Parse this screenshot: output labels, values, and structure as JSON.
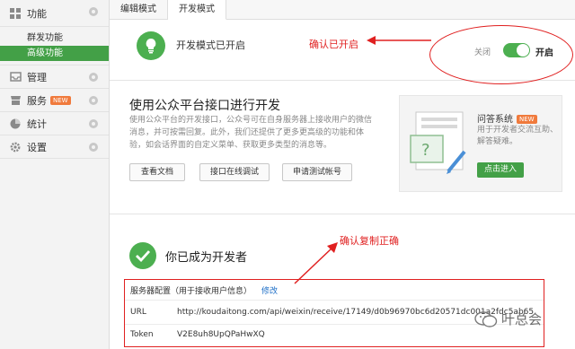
{
  "sidebar": {
    "groups": [
      {
        "label": "功能",
        "icon": "grid-icon"
      },
      {
        "label": "管理",
        "icon": "inbox-icon"
      },
      {
        "label": "服务",
        "icon": "store-icon",
        "badge": "NEW"
      },
      {
        "label": "统计",
        "icon": "pie-icon"
      },
      {
        "label": "设置",
        "icon": "gear-icon"
      }
    ],
    "sub_items": [
      {
        "label": "群发功能"
      },
      {
        "label": "高级功能"
      }
    ]
  },
  "tabs": [
    {
      "label": "编辑模式"
    },
    {
      "label": "开发模式"
    }
  ],
  "dev_mode": {
    "status": "开发模式已开启",
    "annotation": "确认已开启",
    "toggle_off_label": "关闭",
    "toggle_on_label": "开启",
    "toggle_state": "on"
  },
  "api": {
    "title": "使用公众平台接口进行开发",
    "description": "使用公众平台的开发接口，公众号可在自身服务器上接收用户的微信消息，并可按需回复。此外，我们还提供了更多更高级的功能和体验，如会话界面的自定义菜单、获取更多类型的消息等。",
    "buttons": [
      "查看文档",
      "接口在线调试",
      "申请测试帐号"
    ],
    "qa": {
      "title": "问答系统",
      "badge": "NEW",
      "description": "用于开发者交流互助、解答疑难。",
      "button": "点击进入"
    }
  },
  "developer": {
    "title": "你已成为开发者",
    "annotation": "确认复制正确",
    "config_label": "服务器配置（用于接收用户信息）",
    "edit_label": "修改",
    "url_label": "URL",
    "url_value": "http://koudaitong.com/api/weixin/receive/17149/d0b96970bc6d20571dc001a2fdc5ab65",
    "token_label": "Token",
    "token_value": "V2E8uh8UpQPaHwXQ"
  },
  "watermark": {
    "text": "叶总会"
  },
  "colors": {
    "accent": "#43a047",
    "annotation": "#e02020",
    "link": "#1e6fc7"
  }
}
